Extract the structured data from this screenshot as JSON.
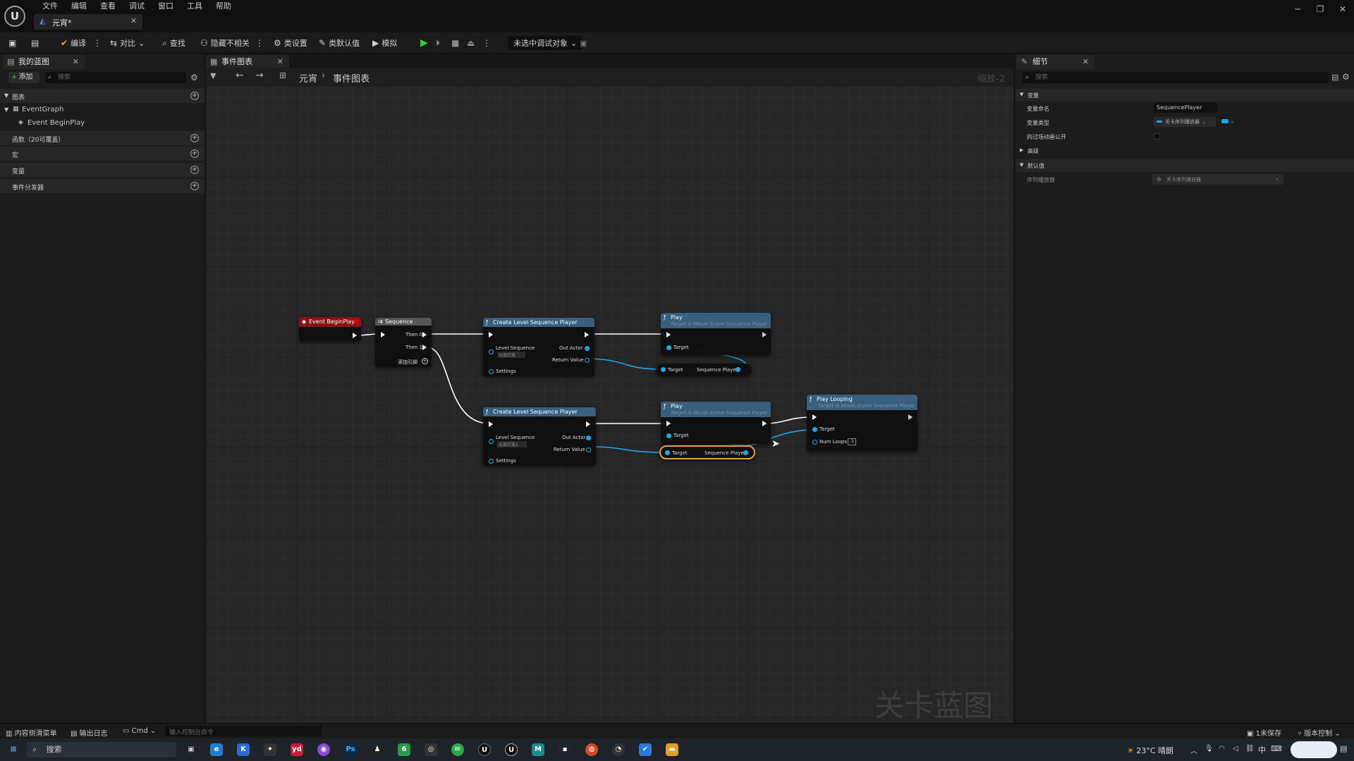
{
  "app": {
    "logo": "U",
    "doc_tab": "元宵*"
  },
  "menu": [
    "文件",
    "编辑",
    "查看",
    "调试",
    "窗口",
    "工具",
    "帮助"
  ],
  "toolbar": {
    "compile": "编译",
    "diff": "对比",
    "find": "查找",
    "hide_unrelated": "隐藏不相关",
    "class_settings": "类设置",
    "class_defaults": "类默认值",
    "simulate": "模拟",
    "debug_target": "未选中调试对象"
  },
  "my_blueprint": {
    "tab": "我的蓝图",
    "add": "添加",
    "search_placeholder": "搜索",
    "sections": [
      {
        "label": "图表"
      },
      {
        "label": "EventGraph"
      },
      {
        "label": "Event BeginPlay"
      },
      {
        "label": "函数（20可覆盖）"
      },
      {
        "label": "宏"
      },
      {
        "label": "变量"
      },
      {
        "label": "事件分发器"
      }
    ]
  },
  "graph": {
    "tab": "事件图表",
    "breadcrumb_root": "元宵",
    "breadcrumb_current": "事件图表",
    "zoom": "缩放-2",
    "watermark": "关卡蓝图",
    "nodes": {
      "begin_play": "Event BeginPlay",
      "sequence": {
        "title": "Sequence",
        "then0": "Then 0",
        "then1": "Then 1",
        "add_pin": "添加引脚"
      },
      "clsp1": {
        "title": "Create Level Sequence Player",
        "level_sequence": "Level Sequence",
        "asset": "元宵灯笼",
        "settings": "Settings",
        "out_actor": "Out Actor",
        "return_value": "Return Value"
      },
      "clsp2": {
        "title": "Create Level Sequence Player",
        "level_sequence": "Level Sequence",
        "asset": "元宵灯笼1",
        "settings": "Settings",
        "out_actor": "Out Actor",
        "return_value": "Return Value"
      },
      "play1": {
        "title": "Play",
        "subtitle": "Target is Movie Scene Sequence Player",
        "target": "Target"
      },
      "play2": {
        "title": "Play",
        "subtitle": "Target is Movie Scene Sequence Player",
        "target": "Target"
      },
      "setter1": {
        "target": "Target",
        "var": "Sequence Player"
      },
      "setter2": {
        "target": "Target",
        "var": "Sequence Player"
      },
      "play_looping": {
        "title": "Play Looping",
        "subtitle": "Target is Movie Scene Sequence Player",
        "target": "Target",
        "num_loops": "Num Loops",
        "num_loops_value": "-1"
      }
    }
  },
  "details": {
    "tab": "细节",
    "search_placeholder": "搜索",
    "section_variable": "变量",
    "var_name_label": "变量命名",
    "var_name_value": "SequencePlayer",
    "var_type_label": "变量类型",
    "var_type_value": "关卡序列播放器",
    "expose_label": "向过场动画公开",
    "advanced": "高级",
    "section_default": "默认值",
    "default_label": "序列播放器",
    "default_value": "关卡序列播放器"
  },
  "statusbar": {
    "content_drawer": "内容侧滑菜单",
    "output_log": "输出日志",
    "cmd": "Cmd",
    "cmd_placeholder": "输入控制台命令",
    "unsaved": "1未保存",
    "source_control": "版本控制"
  },
  "taskbar": {
    "search": "搜索",
    "weather": "23°C 晴朗",
    "ime": "中"
  },
  "colors": {
    "func_head": "#385f7d",
    "event_head": "#8a1414",
    "pin_blue": "#1ea7e6",
    "highlight": "#e8a13a"
  }
}
